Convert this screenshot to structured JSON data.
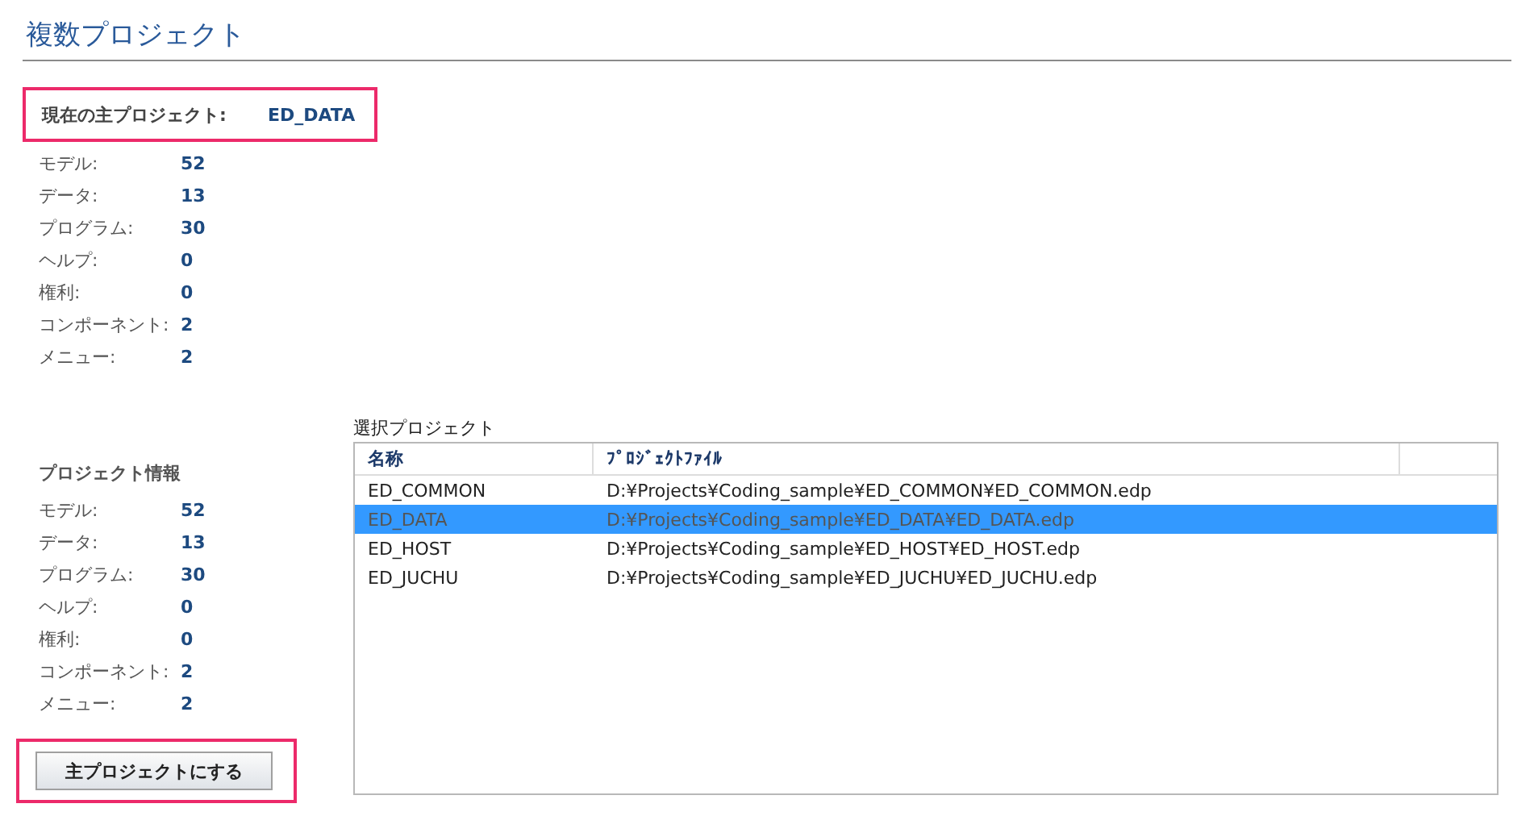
{
  "page_title": "複数プロジェクト",
  "main_project": {
    "label": "現在の主プロジェクト:",
    "value": "ED_DATA"
  },
  "main_stats": [
    {
      "label": "モデル:",
      "value": "52"
    },
    {
      "label": "データ:",
      "value": "13"
    },
    {
      "label": "プログラム:",
      "value": "30"
    },
    {
      "label": "ヘルプ:",
      "value": "0"
    },
    {
      "label": "権利:",
      "value": "0"
    },
    {
      "label": "コンポーネント:",
      "value": "2"
    },
    {
      "label": "メニュー:",
      "value": "2"
    }
  ],
  "project_info": {
    "heading": "プロジェクト情報",
    "stats": [
      {
        "label": "モデル:",
        "value": "52"
      },
      {
        "label": "データ:",
        "value": "13"
      },
      {
        "label": "プログラム:",
        "value": "30"
      },
      {
        "label": "ヘルプ:",
        "value": "0"
      },
      {
        "label": "権利:",
        "value": "0"
      },
      {
        "label": "コンポーネント:",
        "value": "2"
      },
      {
        "label": "メニュー:",
        "value": "2"
      }
    ]
  },
  "set_main_button": "主プロジェクトにする",
  "selection": {
    "label": "選択プロジェクト",
    "columns": [
      "名称",
      "ﾌﾟﾛｼﾞｪｸﾄﾌｧｲﾙ"
    ],
    "rows": [
      {
        "name": "ED_COMMON",
        "file": "D:¥Projects¥Coding_sample¥ED_COMMON¥ED_COMMON.edp",
        "selected": false
      },
      {
        "name": "ED_DATA",
        "file": "D:¥Projects¥Coding_sample¥ED_DATA¥ED_DATA.edp",
        "selected": true
      },
      {
        "name": "ED_HOST",
        "file": "D:¥Projects¥Coding_sample¥ED_HOST¥ED_HOST.edp",
        "selected": false
      },
      {
        "name": "ED_JUCHU",
        "file": "D:¥Projects¥Coding_sample¥ED_JUCHU¥ED_JUCHU.edp",
        "selected": false
      }
    ]
  }
}
